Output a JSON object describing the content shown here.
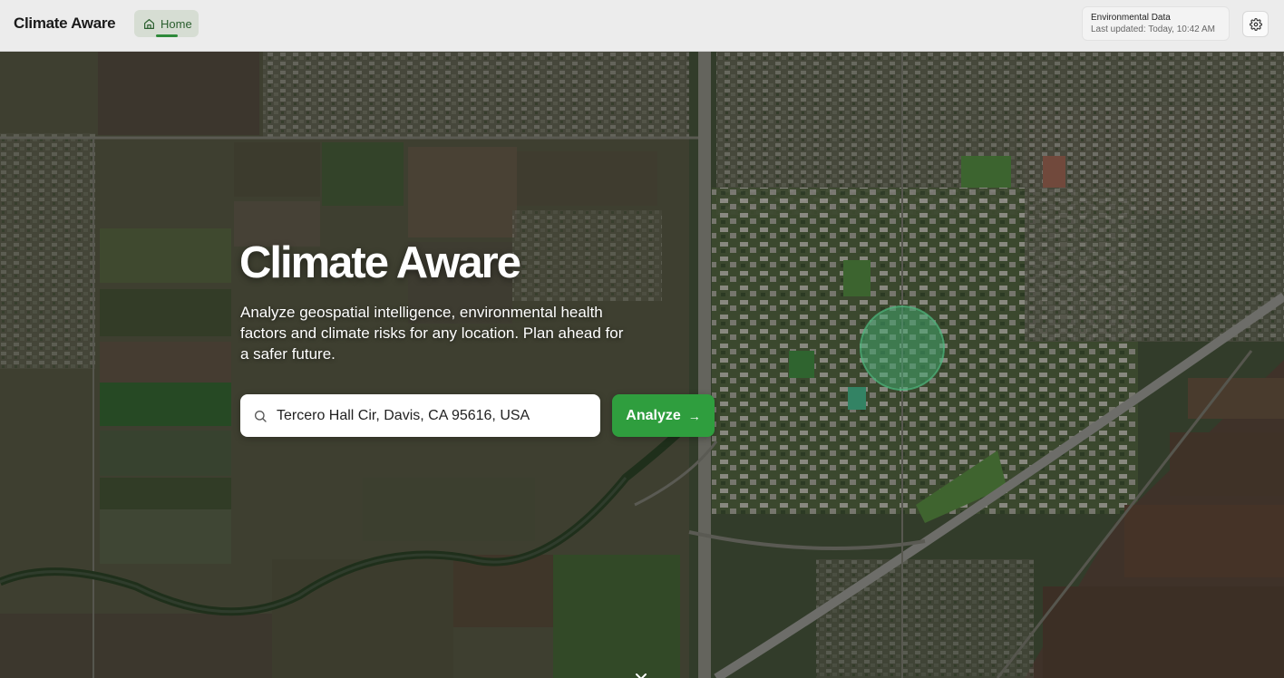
{
  "header": {
    "brand": "Climate Aware",
    "nav_home": "Home",
    "env_title": "Environmental Data",
    "env_updated": "Last updated: Today, 10:42 AM"
  },
  "hero": {
    "title": "Climate Aware",
    "description": "Analyze geospatial intelligence, environmental health factors and climate risks for any location. Plan ahead for a safer future.",
    "search_value": "Tercero Hall Cir, Davis, CA 95616, USA",
    "analyze_label": "Analyze",
    "analyze_arrow": "→"
  },
  "icons": {
    "home": "home-icon",
    "settings": "gear-icon",
    "search": "search-icon",
    "scroll": "chevron-down-icon"
  },
  "colors": {
    "accent": "#2f9e3e",
    "header_bg": "#ececec",
    "highlight": "#4fd18a"
  }
}
